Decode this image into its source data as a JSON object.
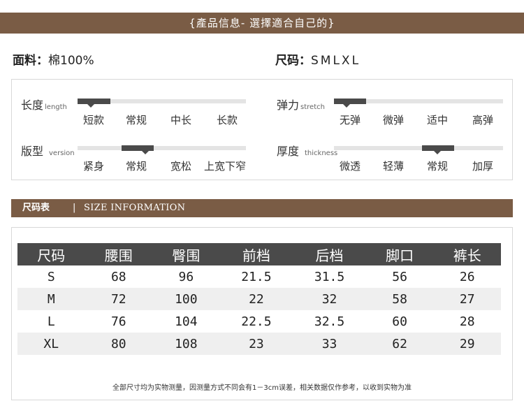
{
  "banner_top": "{產品信息- 選擇適合自己的}",
  "material": {
    "label": "面料：",
    "value": "棉100%"
  },
  "sizes": {
    "label": "尺码：",
    "value": "SMLXL"
  },
  "attributes": [
    {
      "cn": "长度",
      "en": "length",
      "options": [
        "短款",
        "常规",
        "中长",
        "长款"
      ],
      "selected": 0
    },
    {
      "cn": "弹力",
      "en": "stretch",
      "options": [
        "无弹",
        "微弹",
        "适中",
        "高弹"
      ],
      "selected": 0
    },
    {
      "cn": "版型",
      "en": "version",
      "options": [
        "紧身",
        "常规",
        "宽松",
        "上宽下窄"
      ],
      "selected": 1
    },
    {
      "cn": "厚度",
      "en": "thickness",
      "options": [
        "微透",
        "轻薄",
        "常规",
        "加厚"
      ],
      "selected": 2
    }
  ],
  "size_banner": {
    "cn": "尺码表",
    "sep": "|",
    "en": "SIZE INFORMATION"
  },
  "size_table": {
    "headers": [
      "尺码",
      "腰围",
      "臀围",
      "前档",
      "后档",
      "脚口",
      "裤长"
    ],
    "rows": [
      [
        "S",
        "68",
        "96",
        "21.5",
        "31.5",
        "56",
        "26"
      ],
      [
        "M",
        "72",
        "100",
        "22",
        "32",
        "58",
        "27"
      ],
      [
        "L",
        "76",
        "104",
        "22.5",
        "32.5",
        "60",
        "28"
      ],
      [
        "XL",
        "80",
        "108",
        "23",
        "33",
        "62",
        "29"
      ]
    ]
  },
  "note": "全部尺寸均为实物测量，因测量方式不同会有1－3cm误差，相关数据仅作参考，以收到实物为准"
}
